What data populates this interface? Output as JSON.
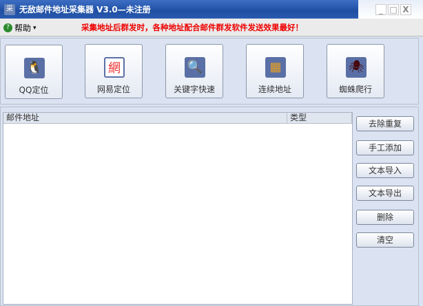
{
  "window": {
    "title": "无敌邮件地址采集器 V3.0—未注册",
    "app_icon": "采",
    "controls": {
      "minimize": "_",
      "maximize": "□",
      "close": "X"
    }
  },
  "menu": {
    "help": "帮助",
    "help_arrow": "▾",
    "notice": "采集地址后群发时，各种地址配合邮件群发软件发送效果最好！"
  },
  "toolbar": [
    {
      "label": "QQ定位",
      "icon": "qq-penguin-icon",
      "glyph": "🐧"
    },
    {
      "label": "网易定位",
      "icon": "netease-icon",
      "glyph": "網"
    },
    {
      "label": "关键字快速",
      "icon": "magnifier-icon",
      "glyph": "🔍"
    },
    {
      "label": "连续地址",
      "icon": "color-strips-icon",
      "glyph": "▦"
    },
    {
      "label": "蜘蛛爬行",
      "icon": "spider-icon",
      "glyph": "🕷"
    }
  ],
  "list": {
    "columns": [
      "邮件地址",
      "类型"
    ],
    "rows": []
  },
  "actions": [
    "去除重复",
    "手工添加",
    "文本导入",
    "文本导出",
    "删除",
    "清空"
  ]
}
